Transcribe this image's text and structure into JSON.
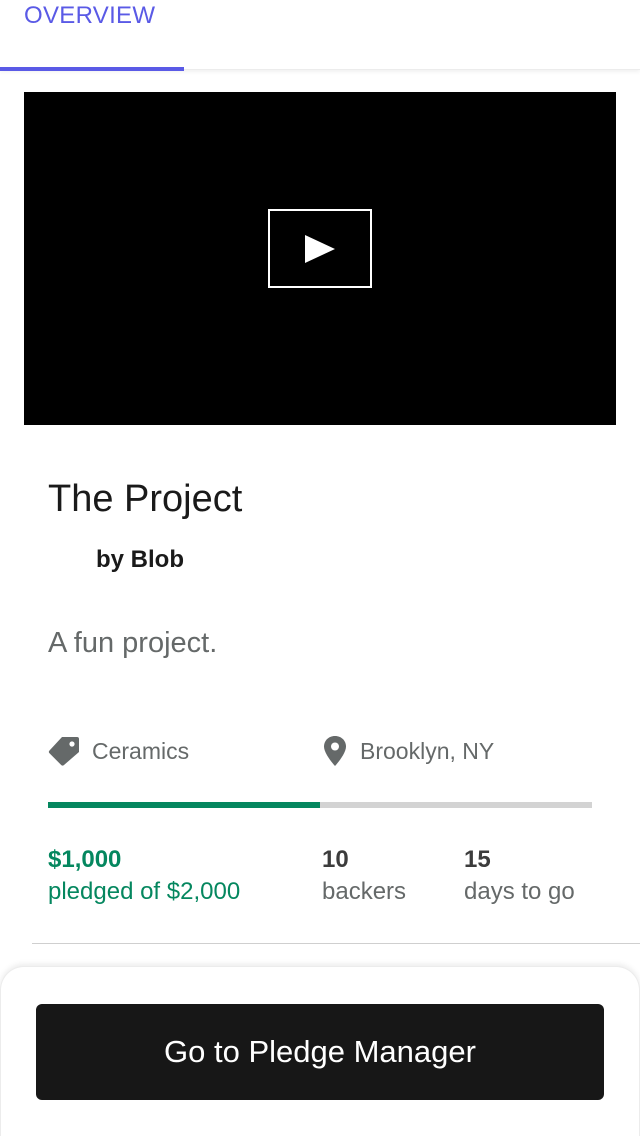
{
  "tabs": [
    {
      "label": "OVERVIEW",
      "selected": true
    }
  ],
  "colors": {
    "accent": "#5a5ae6",
    "success": "#05875f",
    "video_bg": "#000000",
    "button_bg": "#171717"
  },
  "video": {
    "icon": "play-icon"
  },
  "project": {
    "title": "The Project",
    "creator": "by Blob",
    "blurb": "A fun project."
  },
  "meta": {
    "category": {
      "icon": "tag-icon",
      "label": "Ceramics"
    },
    "location": {
      "icon": "location-pin-icon",
      "label": "Brooklyn, NY"
    }
  },
  "funding": {
    "progress": 0.5
  },
  "stats": {
    "pledged": {
      "value": "$1,000",
      "label": "pledged of $2,000"
    },
    "backers": {
      "value": "10",
      "label": "backers"
    },
    "days": {
      "value": "15",
      "label": "days to go"
    }
  },
  "cta": {
    "label": "Go to Pledge Manager"
  }
}
